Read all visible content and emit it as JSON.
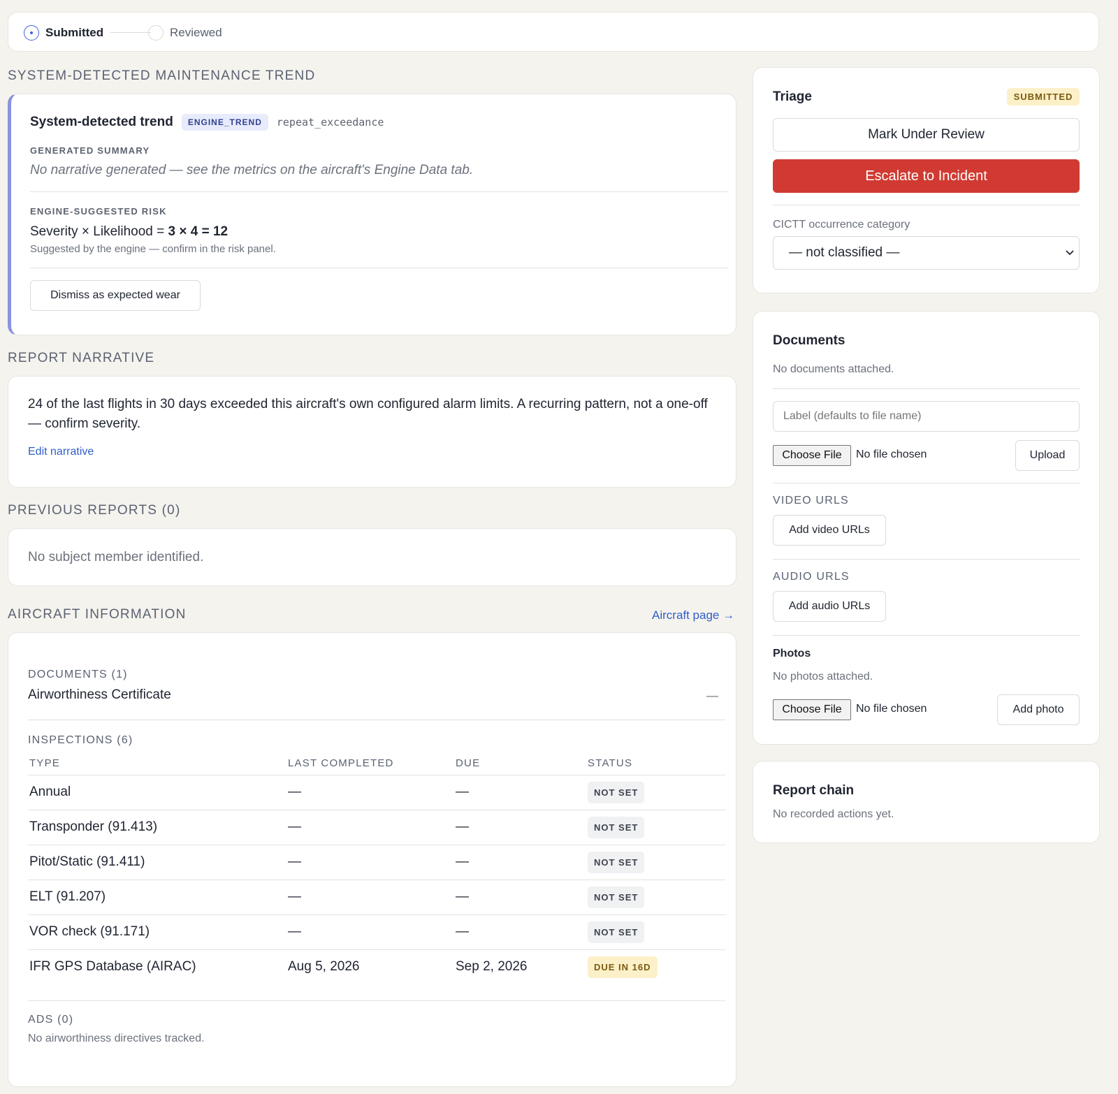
{
  "stepper": {
    "steps": [
      {
        "label": "Submitted",
        "state": "active"
      },
      {
        "label": "Reviewed",
        "state": "pending"
      }
    ]
  },
  "trend_section": {
    "title": "SYSTEM-DETECTED MAINTENANCE TREND",
    "card_title": "System-detected trend",
    "badge": "ENGINE_TREND",
    "code": "repeat_exceedance",
    "summary_label": "GENERATED SUMMARY",
    "summary_text": "No narrative generated — see the metrics on the aircraft's Engine Data tab.",
    "risk_label": "ENGINE-SUGGESTED RISK",
    "risk_prefix": "Severity × Likelihood = ",
    "risk_value": "3 × 4 = 12",
    "risk_note": "Suggested by the engine — confirm in the risk panel.",
    "dismiss_button": "Dismiss as expected wear",
    "accent_color": "#8b93e0"
  },
  "narrative_section": {
    "title": "REPORT NARRATIVE",
    "text": "24 of the last flights in 30 days exceeded this aircraft's own configured alarm limits. A recurring pattern, not a one-off — confirm severity.",
    "edit_link": "Edit narrative"
  },
  "previous_section": {
    "title": "PREVIOUS REPORTS (0)",
    "text": "No subject member identified."
  },
  "aircraft_section": {
    "title": "AIRCRAFT INFORMATION",
    "page_link": "Aircraft page →",
    "documents_label": "DOCUMENTS (1)",
    "documents": [
      {
        "name": "Airworthiness Certificate",
        "value": "—"
      }
    ],
    "inspections_label": "INSPECTIONS (6)",
    "columns": [
      "TYPE",
      "LAST COMPLETED",
      "DUE",
      "STATUS"
    ],
    "inspections": [
      {
        "type": "Annual",
        "last": "—",
        "due": "—",
        "status": "NOT SET",
        "status_kind": "gray"
      },
      {
        "type": "Transponder (91.413)",
        "last": "—",
        "due": "—",
        "status": "NOT SET",
        "status_kind": "gray"
      },
      {
        "type": "Pitot/Static (91.411)",
        "last": "—",
        "due": "—",
        "status": "NOT SET",
        "status_kind": "gray"
      },
      {
        "type": "ELT (91.207)",
        "last": "—",
        "due": "—",
        "status": "NOT SET",
        "status_kind": "gray"
      },
      {
        "type": "VOR check (91.171)",
        "last": "—",
        "due": "—",
        "status": "NOT SET",
        "status_kind": "gray"
      },
      {
        "type": "IFR GPS Database (AIRAC)",
        "last": "Aug 5, 2026",
        "due": "Sep 2, 2026",
        "status": "DUE IN 16D",
        "status_kind": "amber"
      }
    ],
    "ads_label": "ADS (0)",
    "ads_text": "No airworthiness directives tracked."
  },
  "triage": {
    "title": "Triage",
    "badge": "SUBMITTED",
    "review_button": "Mark Under Review",
    "escalate_button": "Escalate to Incident",
    "category_label": "CICTT occurrence category",
    "category_value": "— not classified —"
  },
  "documents_panel": {
    "title": "Documents",
    "empty_text": "No documents attached.",
    "label_placeholder": "Label (defaults to file name)",
    "choose_file": "Choose File",
    "no_file": "No file chosen",
    "upload_button": "Upload",
    "video_label": "VIDEO URLS",
    "video_button": "Add video URLs",
    "audio_label": "AUDIO URLS",
    "audio_button": "Add audio URLs",
    "photos_label": "Photos",
    "photos_empty": "No photos attached.",
    "photo_choose_file": "Choose File",
    "photo_no_file": "No file chosen",
    "add_photo_button": "Add photo"
  },
  "report_chain": {
    "title": "Report chain",
    "text": "No recorded actions yet."
  }
}
